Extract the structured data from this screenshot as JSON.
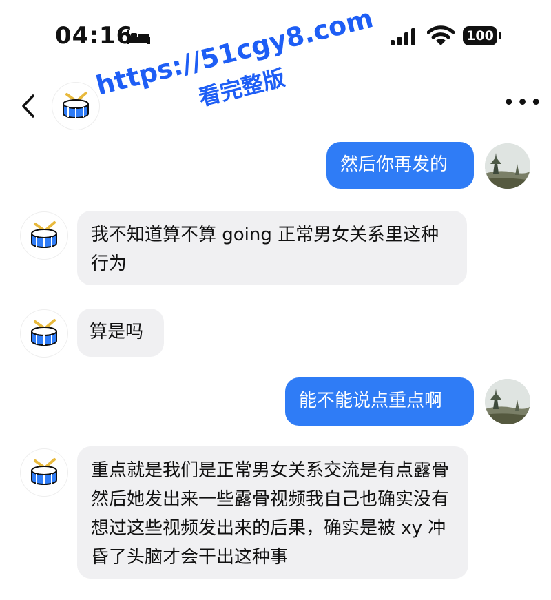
{
  "status_bar": {
    "time": "04:16",
    "battery": "100",
    "icons": [
      "bed-icon",
      "signal-icon",
      "wifi-icon",
      "battery-icon"
    ]
  },
  "header": {
    "contact_name": "",
    "icons": [
      "back-icon",
      "drum-icon",
      "more-icon"
    ]
  },
  "watermark": {
    "url": "https://51cgy8.com",
    "subtitle": "看完整版"
  },
  "messages": [
    {
      "direction": "out",
      "text": "然后你再发的"
    },
    {
      "direction": "in",
      "text": "我不知道算不算 going 正常男女关系里这种行为"
    },
    {
      "direction": "in",
      "text": "算是吗"
    },
    {
      "direction": "out",
      "text": "能不能说点重点啊"
    },
    {
      "direction": "in",
      "text": "重点就是我们是正常男女关系交流是有点露骨然后她发出来一些露骨视频我自己也确实没有想过这些视频发出来的后果，确实是被 xy 冲昏了头脑才会干出这种事"
    }
  ],
  "colors": {
    "outgoing_bubble": "#2f7cf6",
    "incoming_bubble": "#f0f0f2",
    "watermark": "#1e5ef5",
    "drum_blue": "#2f7cf6",
    "drum_gold": "#e8b93c"
  }
}
